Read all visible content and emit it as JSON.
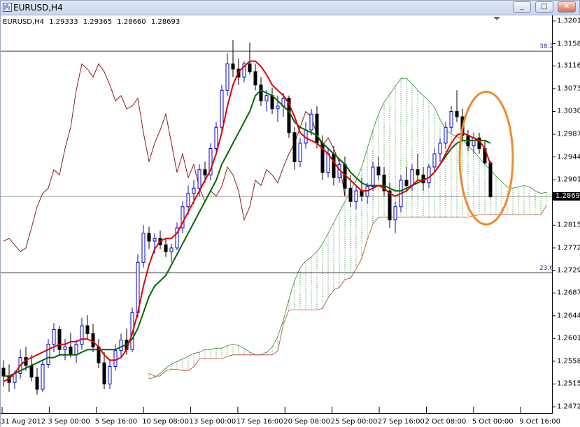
{
  "window": {
    "title": "EURUSD,H4",
    "buttons": [
      "_",
      "□",
      "✕"
    ]
  },
  "colors": {
    "tenkan": "#dd0000",
    "kijun": "#006600",
    "chikou": "#8b1a1a",
    "kumo_bull": "#2e8b2e",
    "kumo_bear": "#c0392b",
    "candle_bull": "#0000cc",
    "candle_bear": "#000000",
    "highlight_ellipse": "#f08a30",
    "fibo_line": "#000000"
  },
  "chart_data": {
    "type": "line",
    "symbol": "EURUSD,H4",
    "ohlc": [
      "1.29333",
      "1.29365",
      "1.28660",
      "1.28693"
    ],
    "current_price": "1.28693",
    "ylim": [
      1.2472,
      1.3201
    ],
    "yticks": [
      "1.32010",
      "1.31580",
      "1.31160",
      "1.30730",
      "1.30300",
      "1.29870",
      "1.29440",
      "1.29010",
      "1.28150",
      "1.27720",
      "1.27290",
      "1.26870",
      "1.26440",
      "1.26010",
      "1.25580",
      "1.25150",
      "1.24720"
    ],
    "xticks": [
      "31 Aug 2012",
      "3 Sep 00:00",
      "5 Sep 16:00",
      "10 Sep 08:00",
      "13 Sep 00:00",
      "17 Sep 16:00",
      "20 Sep 08:00",
      "25 Sep 00:00",
      "27 Sep 16:00",
      "2 Oct 08:00",
      "5 Oct 00:00",
      "9 Oct 16:00"
    ],
    "fibo_levels": [
      {
        "label": "38.2",
        "price": 1.3144
      },
      {
        "label": "23.6",
        "price": 1.2725
      }
    ],
    "candles": [
      [
        1.2545,
        1.256,
        1.251,
        1.253
      ],
      [
        1.253,
        1.2552,
        1.25,
        1.2518
      ],
      [
        1.2518,
        1.254,
        1.2505,
        1.2535
      ],
      [
        1.2535,
        1.258,
        1.2525,
        1.2565
      ],
      [
        1.2565,
        1.2585,
        1.254,
        1.255
      ],
      [
        1.255,
        1.257,
        1.252,
        1.2528
      ],
      [
        1.2528,
        1.2545,
        1.2495,
        1.2505
      ],
      [
        1.2505,
        1.256,
        1.25,
        1.2552
      ],
      [
        1.2552,
        1.26,
        1.2545,
        1.259
      ],
      [
        1.259,
        1.263,
        1.2575,
        1.2618
      ],
      [
        1.2618,
        1.2625,
        1.257,
        1.258
      ],
      [
        1.258,
        1.26,
        1.256,
        1.2585
      ],
      [
        1.2585,
        1.2612,
        1.2565,
        1.257
      ],
      [
        1.257,
        1.2598,
        1.2555,
        1.259
      ],
      [
        1.259,
        1.264,
        1.258,
        1.2625
      ],
      [
        1.2625,
        1.2645,
        1.26,
        1.261
      ],
      [
        1.261,
        1.2628,
        1.2575,
        1.2585
      ],
      [
        1.2585,
        1.26,
        1.2545,
        1.2555
      ],
      [
        1.2555,
        1.2575,
        1.2505,
        1.2515
      ],
      [
        1.2515,
        1.256,
        1.2505,
        1.2548
      ],
      [
        1.2548,
        1.259,
        1.254,
        1.2578
      ],
      [
        1.2578,
        1.261,
        1.2565,
        1.2598
      ],
      [
        1.2598,
        1.262,
        1.257,
        1.258
      ],
      [
        1.258,
        1.266,
        1.2575,
        1.265
      ],
      [
        1.265,
        1.276,
        1.264,
        1.2745
      ],
      [
        1.2745,
        1.2815,
        1.2735,
        1.28
      ],
      [
        1.28,
        1.2812,
        1.277,
        1.2785
      ],
      [
        1.2785,
        1.28,
        1.276,
        1.279
      ],
      [
        1.279,
        1.2805,
        1.277,
        1.2778
      ],
      [
        1.2778,
        1.279,
        1.2755,
        1.2765
      ],
      [
        1.2765,
        1.278,
        1.2745,
        1.2772
      ],
      [
        1.2772,
        1.282,
        1.2768,
        1.281
      ],
      [
        1.281,
        1.286,
        1.28,
        1.285
      ],
      [
        1.285,
        1.289,
        1.2835,
        1.2875
      ],
      [
        1.2875,
        1.29,
        1.2855,
        1.2885
      ],
      [
        1.2885,
        1.293,
        1.287,
        1.292
      ],
      [
        1.292,
        1.2935,
        1.2895,
        1.291
      ],
      [
        1.291,
        1.297,
        1.29,
        1.296
      ],
      [
        1.296,
        1.301,
        1.295,
        1.3
      ],
      [
        1.3,
        1.308,
        1.299,
        1.307
      ],
      [
        1.307,
        1.314,
        1.306,
        1.312
      ],
      [
        1.312,
        1.3165,
        1.3095,
        1.311
      ],
      [
        1.311,
        1.313,
        1.308,
        1.3095
      ],
      [
        1.3095,
        1.3125,
        1.3085,
        1.312
      ],
      [
        1.312,
        1.316,
        1.31,
        1.3105
      ],
      [
        1.3105,
        1.312,
        1.307,
        1.308
      ],
      [
        1.308,
        1.3095,
        1.304,
        1.305
      ],
      [
        1.305,
        1.307,
        1.303,
        1.306
      ],
      [
        1.306,
        1.3075,
        1.3025,
        1.3035
      ],
      [
        1.3035,
        1.306,
        1.301,
        1.304
      ],
      [
        1.304,
        1.3065,
        1.302,
        1.3055
      ],
      [
        1.3055,
        1.306,
        1.298,
        1.299
      ],
      [
        1.299,
        1.3,
        1.292,
        1.2935
      ],
      [
        1.2935,
        1.298,
        1.2925,
        1.297
      ],
      [
        1.297,
        1.301,
        1.296,
        1.2995
      ],
      [
        1.2995,
        1.3035,
        1.2985,
        1.3025
      ],
      [
        1.3025,
        1.304,
        1.296,
        1.297
      ],
      [
        1.297,
        1.2985,
        1.29,
        1.2915
      ],
      [
        1.2915,
        1.296,
        1.2905,
        1.295
      ],
      [
        1.295,
        1.2965,
        1.289,
        1.2905
      ],
      [
        1.2905,
        1.294,
        1.2895,
        1.293
      ],
      [
        1.293,
        1.2945,
        1.287,
        1.2885
      ],
      [
        1.2885,
        1.291,
        1.285,
        1.286
      ],
      [
        1.286,
        1.289,
        1.2845,
        1.288
      ],
      [
        1.288,
        1.2905,
        1.286,
        1.287
      ],
      [
        1.287,
        1.2895,
        1.2855,
        1.2888
      ],
      [
        1.2888,
        1.2935,
        1.288,
        1.2925
      ],
      [
        1.2925,
        1.2945,
        1.29,
        1.291
      ],
      [
        1.291,
        1.2925,
        1.287,
        1.288
      ],
      [
        1.288,
        1.2895,
        1.281,
        1.2825
      ],
      [
        1.2825,
        1.286,
        1.28,
        1.285
      ],
      [
        1.285,
        1.291,
        1.284,
        1.29
      ],
      [
        1.29,
        1.2925,
        1.288,
        1.289
      ],
      [
        1.289,
        1.293,
        1.288,
        1.292
      ],
      [
        1.292,
        1.295,
        1.29,
        1.291
      ],
      [
        1.291,
        1.2925,
        1.288,
        1.2895
      ],
      [
        1.2895,
        1.293,
        1.2885,
        1.2925
      ],
      [
        1.2925,
        1.296,
        1.2915,
        1.295
      ],
      [
        1.295,
        1.298,
        1.2935,
        1.297
      ],
      [
        1.297,
        1.301,
        1.296,
        1.3
      ],
      [
        1.3,
        1.304,
        1.299,
        1.303
      ],
      [
        1.303,
        1.307,
        1.301,
        1.302
      ],
      [
        1.302,
        1.3035,
        1.2975,
        1.2985
      ],
      [
        1.2985,
        1.2995,
        1.2955,
        1.2965
      ],
      [
        1.2965,
        1.299,
        1.295,
        1.298
      ],
      [
        1.298,
        1.299,
        1.295,
        1.296
      ],
      [
        1.296,
        1.2975,
        1.293,
        1.2933
      ],
      [
        1.2933,
        1.2937,
        1.2866,
        1.2869
      ]
    ],
    "tenkan": [
      1.252,
      1.2525,
      1.2535,
      1.255,
      1.256,
      1.2565,
      1.257,
      1.2575,
      1.258,
      1.2585,
      1.259,
      1.259,
      1.2595,
      1.2595,
      1.26,
      1.26,
      1.2595,
      1.2585,
      1.257,
      1.256,
      1.256,
      1.2565,
      1.258,
      1.261,
      1.265,
      1.27,
      1.274,
      1.277,
      1.2785,
      1.279,
      1.279,
      1.28,
      1.282,
      1.284,
      1.286,
      1.288,
      1.29,
      1.292,
      1.295,
      1.299,
      1.304,
      1.308,
      1.3105,
      1.3115,
      1.3125,
      1.3125,
      1.3115,
      1.31,
      1.308,
      1.307,
      1.306,
      1.3045,
      1.302,
      1.299,
      1.298,
      1.2975,
      1.297,
      1.296,
      1.295,
      1.2935,
      1.292,
      1.291,
      1.29,
      1.289,
      1.288,
      1.288,
      1.2885,
      1.289,
      1.2885,
      1.2875,
      1.287,
      1.2875,
      1.288,
      1.289,
      1.29,
      1.29,
      1.2905,
      1.2915,
      1.293,
      1.295,
      1.297,
      1.2985,
      1.299,
      1.2985,
      1.298,
      1.2975,
      1.296,
      1.293
    ],
    "kijun": [
      1.253,
      1.253,
      1.2535,
      1.254,
      1.2545,
      1.255,
      1.2555,
      1.256,
      1.2565,
      1.2565,
      1.257,
      1.257,
      1.257,
      1.257,
      1.2575,
      1.258,
      1.258,
      1.258,
      1.258,
      1.258,
      1.258,
      1.2585,
      1.259,
      1.26,
      1.262,
      1.265,
      1.268,
      1.27,
      1.271,
      1.272,
      1.274,
      1.276,
      1.278,
      1.28,
      1.282,
      1.284,
      1.286,
      1.288,
      1.29,
      1.293,
      1.295,
      1.297,
      1.299,
      1.301,
      1.303,
      1.306,
      1.307,
      1.3065,
      1.306,
      1.305,
      1.304,
      1.303,
      1.301,
      1.3,
      1.2995,
      1.299,
      1.2985,
      1.297,
      1.296,
      1.295,
      1.294,
      1.293,
      1.2915,
      1.2905,
      1.2895,
      1.289,
      1.289,
      1.289,
      1.289,
      1.2885,
      1.288,
      1.288,
      1.2885,
      1.289,
      1.2895,
      1.29,
      1.2905,
      1.2915,
      1.293,
      1.2945,
      1.296,
      1.297,
      1.2975,
      1.2975,
      1.2975,
      1.2975,
      1.2975,
      1.297
    ]
  }
}
